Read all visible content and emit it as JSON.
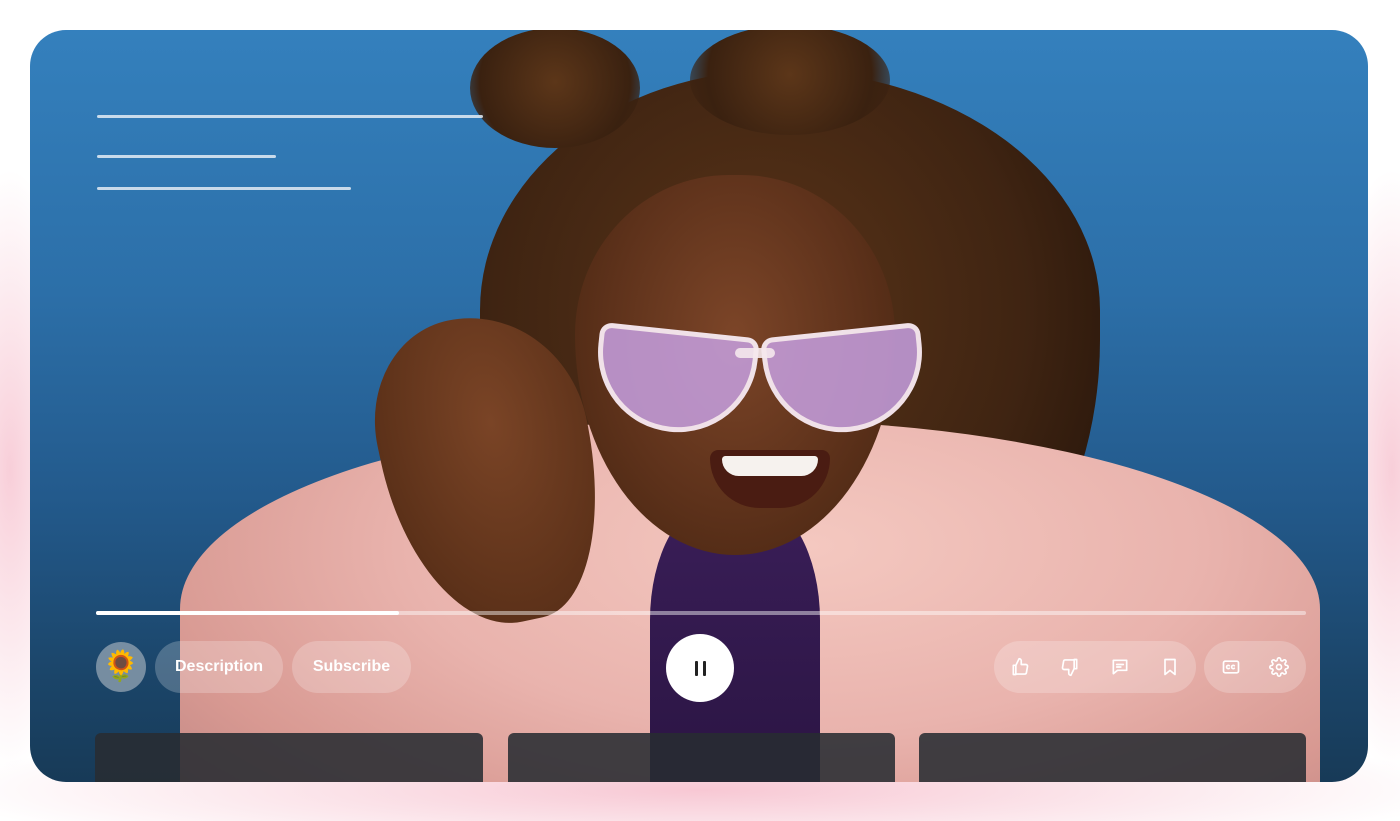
{
  "player": {
    "description_label": "Description",
    "subscribe_label": "Subscribe",
    "progress_fraction": 0.25,
    "channel_avatar_icon": "sunflower-icon",
    "play_state_icon": "pause-icon",
    "actions": [
      "thumbs-up-icon",
      "thumbs-down-icon",
      "comment-icon",
      "bookmark-icon"
    ],
    "settings": [
      "closed-captions-icon",
      "settings-gear-icon"
    ]
  },
  "colors": {
    "background_top": "#3480bd",
    "background_bottom": "#173a57",
    "glow": "#f6becc",
    "control_surface": "rgba(255,255,255,0.22)",
    "card_surface": "#282c32"
  }
}
